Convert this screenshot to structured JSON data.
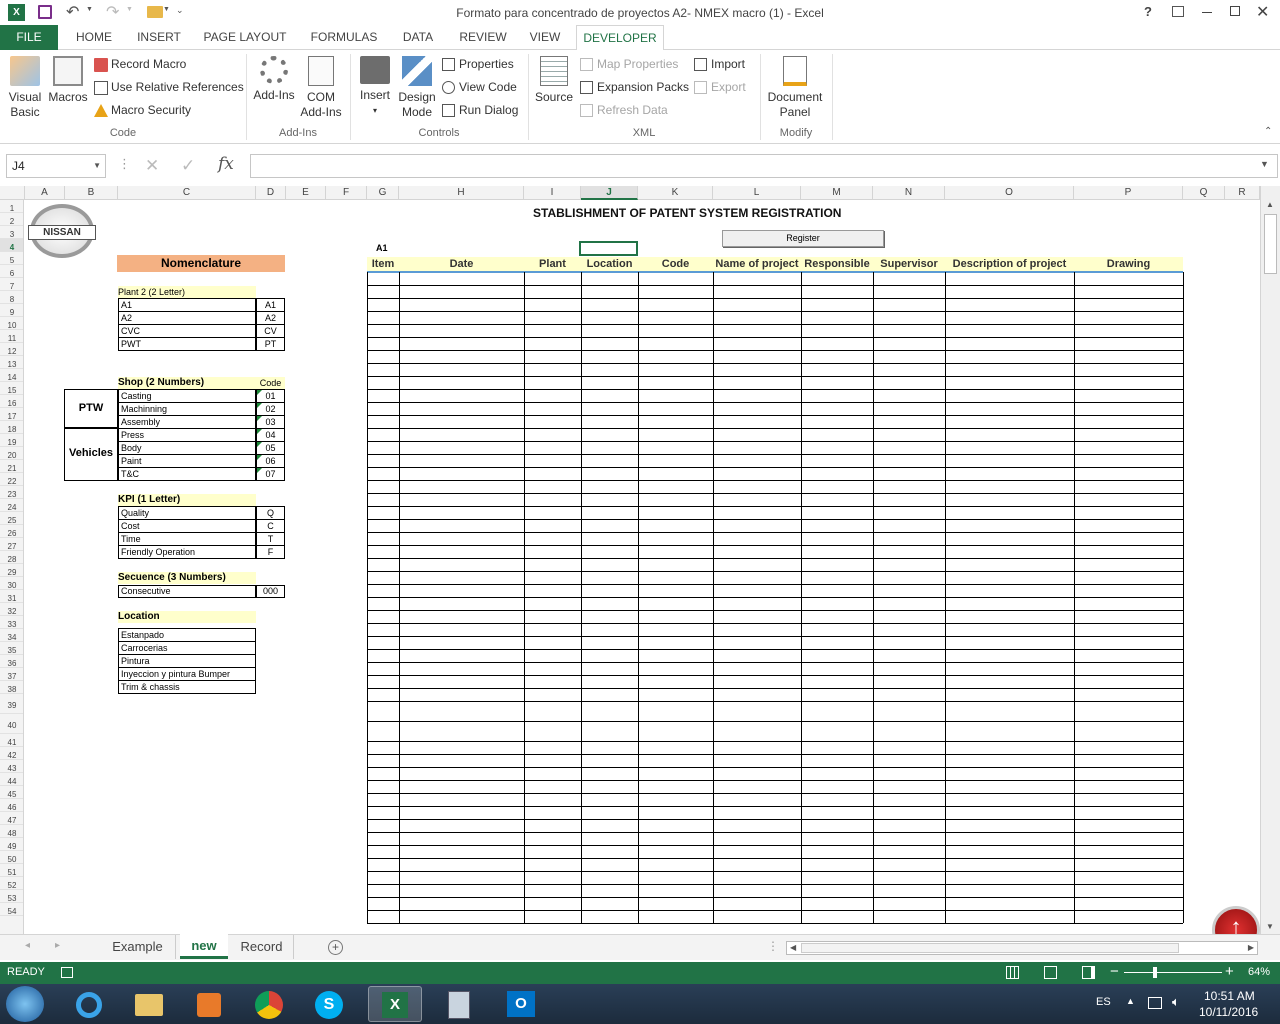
{
  "window": {
    "title": "Formato para concentrado de proyectos  A2- NMEX macro (1) - Excel",
    "help": "?"
  },
  "ribbon_tabs": [
    "FILE",
    "HOME",
    "INSERT",
    "PAGE LAYOUT",
    "FORMULAS",
    "DATA",
    "REVIEW",
    "VIEW",
    "DEVELOPER"
  ],
  "ribbon": {
    "code": {
      "visual_basic": "Visual Basic",
      "visual_basic_l1": "Visual",
      "visual_basic_l2": "Basic",
      "macros": "Macros",
      "record_macro": "Record Macro",
      "use_relative": "Use Relative References",
      "macro_security": "Macro Security",
      "label": "Code"
    },
    "addins": {
      "addins": "Add-Ins",
      "com_l1": "COM",
      "com_l2": "Add-Ins",
      "label": "Add-Ins"
    },
    "controls": {
      "insert": "Insert",
      "design_l1": "Design",
      "design_l2": "Mode",
      "properties": "Properties",
      "view_code": "View Code",
      "run_dialog": "Run Dialog",
      "label": "Controls"
    },
    "xml": {
      "source": "Source",
      "map_properties": "Map Properties",
      "expansion_packs": "Expansion Packs",
      "refresh_data": "Refresh Data",
      "import": "Import",
      "export": "Export",
      "label": "XML"
    },
    "modify": {
      "doc_l1": "Document",
      "doc_l2": "Panel",
      "label": "Modify"
    }
  },
  "formula_bar": {
    "name_box": "J4",
    "fx": "fx",
    "value": ""
  },
  "columns": [
    "A",
    "B",
    "C",
    "D",
    "E",
    "F",
    "G",
    "H",
    "I",
    "J",
    "K",
    "L",
    "M",
    "N",
    "O",
    "P",
    "Q",
    "R"
  ],
  "rows": [
    "1",
    "2",
    "3",
    "4",
    "5",
    "6",
    "7",
    "8",
    "9",
    "10",
    "11",
    "12",
    "13",
    "14",
    "15",
    "16",
    "17",
    "18",
    "19",
    "20",
    "21",
    "22",
    "23",
    "24",
    "25",
    "26",
    "27",
    "28",
    "29",
    "30",
    "31",
    "32",
    "33",
    "34",
    "35",
    "36",
    "37",
    "38",
    "39",
    "40",
    "41",
    "42",
    "43",
    "44",
    "45",
    "46",
    "47",
    "48",
    "49",
    "50",
    "51",
    "52",
    "53",
    "54"
  ],
  "sheet": {
    "logo_text": "NISSAN",
    "main_title": "STABLISHMENT  OF PATENT SYSTEM REGISTRATION",
    "a1_label": "A1",
    "register_button": "Register",
    "nomenclature": "Nomenclature",
    "plant_title": "Plant 2 (2 Letter)",
    "plants": [
      {
        "name": "A1",
        "code": "A1"
      },
      {
        "name": "A2",
        "code": "A2"
      },
      {
        "name": "CVC",
        "code": "CV"
      },
      {
        "name": "PWT",
        "code": "PT"
      }
    ],
    "shop_title": "Shop (2 Numbers)",
    "shop_code_header": "Code",
    "shop_group_ptw": "PTW",
    "shop_group_vehicles": "Vehicles",
    "shops": [
      {
        "name": "Casting",
        "code": "01"
      },
      {
        "name": "Machinning",
        "code": "02"
      },
      {
        "name": "Assembly",
        "code": "03"
      },
      {
        "name": "Press",
        "code": "04"
      },
      {
        "name": "Body",
        "code": "05"
      },
      {
        "name": "Paint",
        "code": "06"
      },
      {
        "name": "T&C",
        "code": "07"
      }
    ],
    "kpi_title": "KPI (1 Letter)",
    "kpis": [
      {
        "name": "Quality",
        "code": "Q"
      },
      {
        "name": "Cost",
        "code": "C"
      },
      {
        "name": "Time",
        "code": "T"
      },
      {
        "name": "Friendly Operation",
        "code": "F"
      }
    ],
    "sequence_title": "Secuence (3 Numbers)",
    "sequence": {
      "name": "Consecutive",
      "code": "000"
    },
    "location_title": "Location",
    "locations": [
      "Estanpado",
      "Carrocerias",
      "Pintura",
      "Inyeccion y pintura Bumper",
      "Trim & chassis"
    ],
    "table_headers": [
      "Item",
      "Date",
      "Plant",
      "Location",
      "Code",
      "Name of project",
      "Responsible",
      "Supervisor",
      "Description of project",
      "Drawing"
    ]
  },
  "sheet_tabs": [
    "Example",
    "new",
    "Record"
  ],
  "status": {
    "ready": "READY",
    "zoom": "64%"
  },
  "taskbar": {
    "lang": "ES",
    "time": "10:51 AM",
    "date": "10/11/2016"
  },
  "colors": {
    "excel_green": "#217346",
    "nomenclature_bg": "#f4b183",
    "yellow_header": "#ffffcc"
  }
}
